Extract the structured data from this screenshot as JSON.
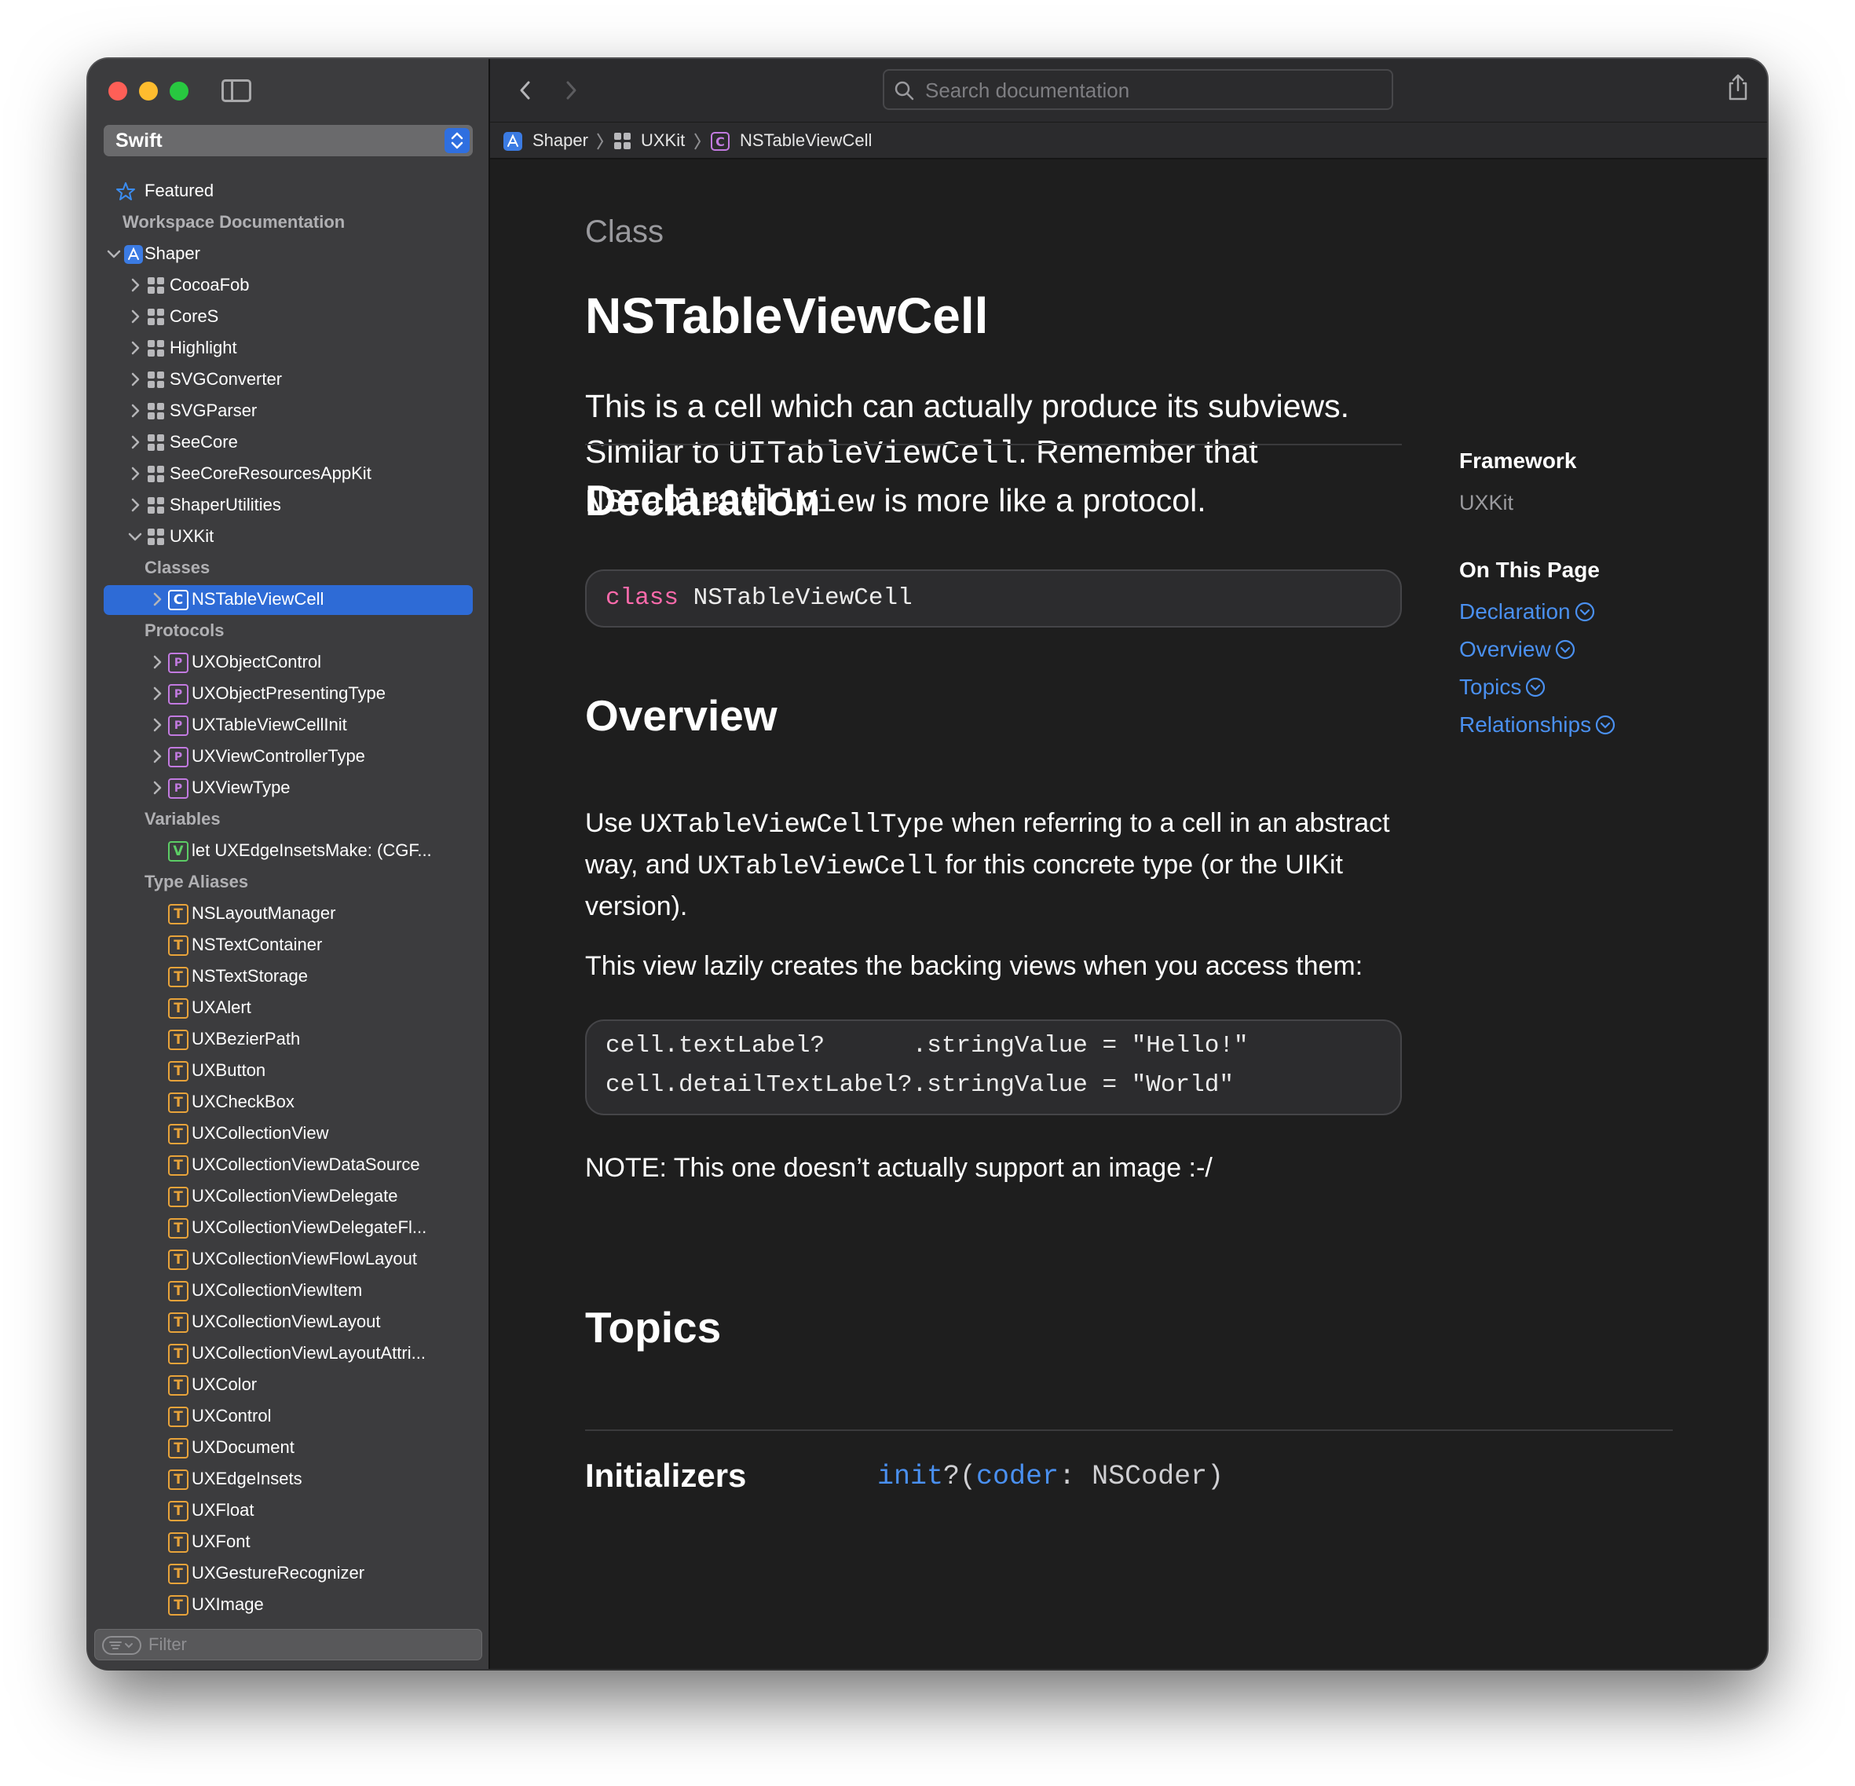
{
  "colors": {
    "accent": "#2e6bd6",
    "link": "#4a90f0",
    "keyword": "#fc6aab",
    "type_alias": "#e8a33a",
    "protocol": "#c27ae0",
    "variable": "#5ccd65"
  },
  "sidebar": {
    "language": "Swift",
    "featured": "Featured",
    "workspace_heading": "Workspace Documentation",
    "project": "Shaper",
    "modules": [
      "CocoaFob",
      "CoreS",
      "Highlight",
      "SVGConverter",
      "SVGParser",
      "SeeCore",
      "SeeCoreResourcesAppKit",
      "ShaperUtilities",
      "UXKit"
    ],
    "sections": {
      "classes": "Classes",
      "protocols": "Protocols",
      "variables": "Variables",
      "type_aliases": "Type Aliases"
    },
    "classes": [
      "NSTableViewCell"
    ],
    "protocols": [
      "UXObjectControl",
      "UXObjectPresentingType",
      "UXTableViewCellInit",
      "UXViewControllerType",
      "UXViewType"
    ],
    "variables": [
      "let UXEdgeInsetsMake: (CGF..."
    ],
    "type_aliases": [
      "NSLayoutManager",
      "NSTextContainer",
      "NSTextStorage",
      "UXAlert",
      "UXBezierPath",
      "UXButton",
      "UXCheckBox",
      "UXCollectionView",
      "UXCollectionViewDataSource",
      "UXCollectionViewDelegate",
      "UXCollectionViewDelegateFl...",
      "UXCollectionViewFlowLayout",
      "UXCollectionViewItem",
      "UXCollectionViewLayout",
      "UXCollectionViewLayoutAttri...",
      "UXColor",
      "UXControl",
      "UXDocument",
      "UXEdgeInsets",
      "UXFloat",
      "UXFont",
      "UXGestureRecognizer",
      "UXImage"
    ],
    "badges": {
      "class": "C",
      "protocol": "P",
      "variable": "V",
      "type_alias": "T"
    },
    "filter_placeholder": "Filter"
  },
  "toolbar": {
    "search_placeholder": "Search documentation"
  },
  "breadcrumb": [
    "Shaper",
    "UXKit",
    "NSTableViewCell"
  ],
  "doc": {
    "kicker": "Class",
    "title": "NSTableViewCell",
    "abstract": {
      "p1": "This is a cell which can actually produce its subviews. Similar to ",
      "code1": "UITableViewCell",
      "p2": ". Remember that ",
      "code2": "NSTableCellView",
      "p3": " is more like a protocol."
    },
    "declaration_heading": "Declaration",
    "declaration": {
      "keyword": "class",
      "name": "NSTableViewCell"
    },
    "overview_heading": "Overview",
    "overview_p1": {
      "a": "Use ",
      "code1": "UXTableViewCellType",
      "b": " when referring to a cell in an abstract way, and ",
      "code2": "UXTableViewCell",
      "c": " for this concrete type (or the UIKit version)."
    },
    "overview_p2": "This view lazily creates the backing views when you access them:",
    "code_lines": [
      "cell.textLabel?      .stringValue = \"Hello!\"",
      "cell.detailTextLabel?.stringValue = \"World\""
    ],
    "note": "NOTE: This one doesn’t actually support an image :-/",
    "topics_heading": "Topics",
    "initializers_heading": "Initializers",
    "initializer": {
      "name": "init",
      "optional": "?(",
      "label": "coder",
      "rest": ": NSCoder)"
    }
  },
  "aside": {
    "framework_heading": "Framework",
    "framework": "UXKit",
    "on_this_page_heading": "On This Page",
    "links": [
      "Declaration",
      "Overview",
      "Topics",
      "Relationships"
    ]
  }
}
